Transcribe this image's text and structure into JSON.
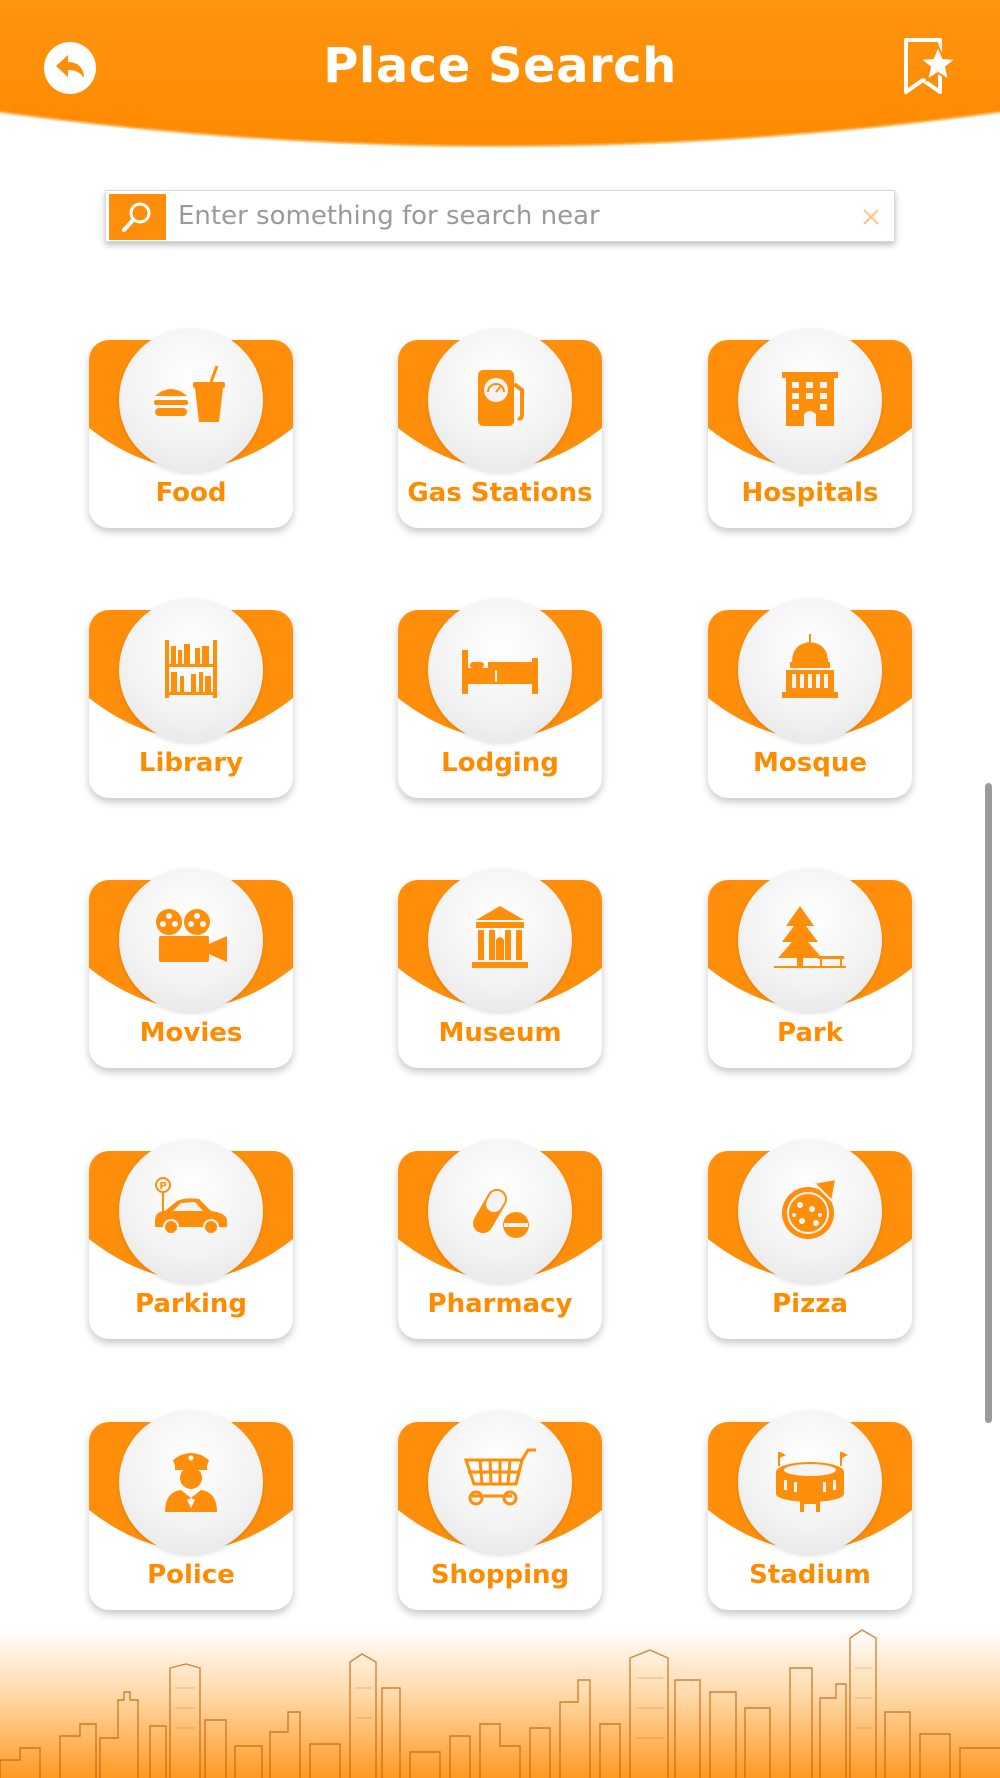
{
  "header": {
    "title": "Place Search",
    "back_icon": "back-arrow-icon",
    "bookmark_icon": "bookmark-star-icon",
    "color": "#ff8f0a"
  },
  "search": {
    "placeholder": "Enter something for search near",
    "value": "",
    "icon": "search-icon",
    "clear_icon": "close-icon"
  },
  "accent_color": "#ff8c00",
  "categories": [
    {
      "label": "Food",
      "icon": "food-icon"
    },
    {
      "label": "Gas Stations",
      "icon": "gas-pump-icon"
    },
    {
      "label": "Hospitals",
      "icon": "hospital-icon"
    },
    {
      "label": "Library",
      "icon": "bookshelf-icon"
    },
    {
      "label": "Lodging",
      "icon": "bed-icon"
    },
    {
      "label": "Mosque",
      "icon": "mosque-icon"
    },
    {
      "label": "Movies",
      "icon": "movie-camera-icon"
    },
    {
      "label": "Museum",
      "icon": "museum-icon"
    },
    {
      "label": "Park",
      "icon": "tree-bench-icon"
    },
    {
      "label": "Parking",
      "icon": "parking-car-icon"
    },
    {
      "label": "Pharmacy",
      "icon": "pill-icon"
    },
    {
      "label": "Pizza",
      "icon": "pizza-icon"
    },
    {
      "label": "Police",
      "icon": "police-officer-icon"
    },
    {
      "label": "Shopping",
      "icon": "shopping-cart-icon"
    },
    {
      "label": "Stadium",
      "icon": "stadium-icon"
    }
  ]
}
